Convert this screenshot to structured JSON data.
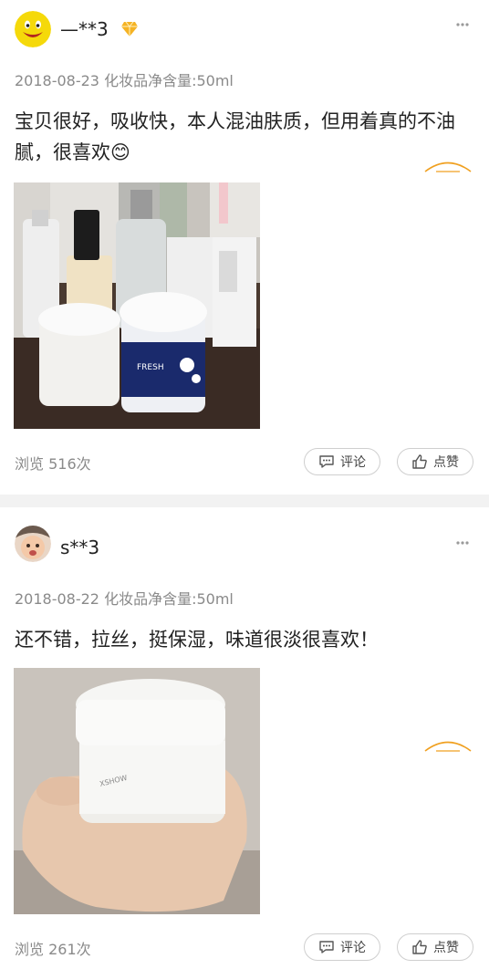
{
  "reviews": [
    {
      "username": "—**3",
      "date": "2018-08-23",
      "spec": "化妆品净含量:50ml",
      "content": "宝贝很好，吸收快，本人混油肤质，但用着真的不油腻，很喜欢😊",
      "views": "浏览 516次",
      "comment_label": "评论",
      "like_label": "点赞",
      "vip": true
    },
    {
      "username": "s**3",
      "date": "2018-08-22",
      "spec": "化妆品净含量:50ml",
      "content": "还不错，拉丝，挺保湿，味道很淡很喜欢！",
      "views": "浏览 261次",
      "comment_label": "评论",
      "like_label": "点赞",
      "vip": false
    }
  ],
  "colors": {
    "meta": "#8a8a8a",
    "accent": "#f0a020",
    "separator": "#f2f2f2"
  }
}
